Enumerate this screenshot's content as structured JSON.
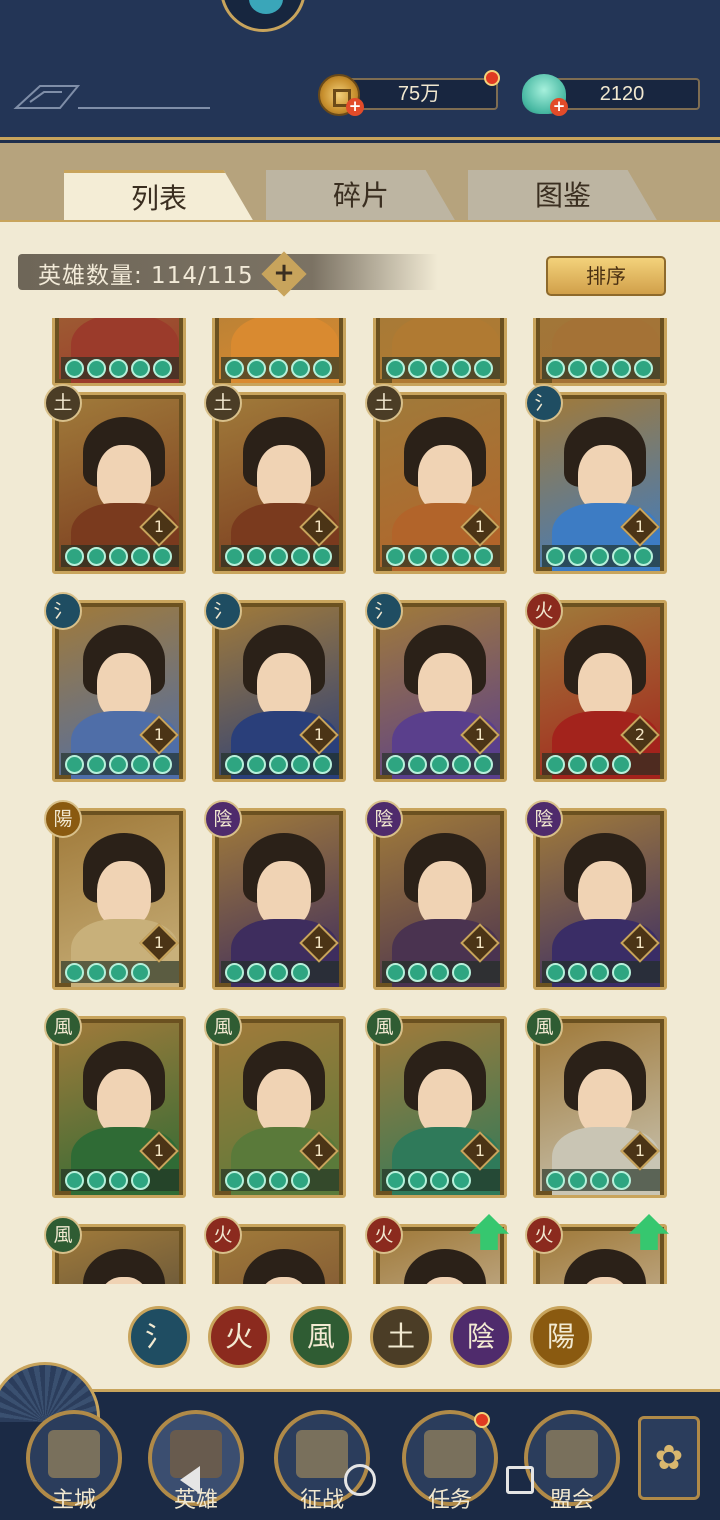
{
  "header": {
    "currencies": [
      {
        "name": "coin",
        "value": "75万",
        "icon": "coin-icon",
        "has_red_dot": true
      },
      {
        "name": "jade",
        "value": "2120",
        "icon": "shell-icon",
        "has_red_dot": false
      }
    ]
  },
  "tabs": [
    {
      "label": "列表",
      "active": true
    },
    {
      "label": "碎片",
      "active": false
    },
    {
      "label": "图鉴",
      "active": false
    }
  ],
  "hero_count": {
    "text": "英雄数量: 114/115"
  },
  "sort_button": {
    "label": "排序"
  },
  "elements": {
    "water": {
      "glyph": "氵",
      "color": "#1f4d62"
    },
    "fire": {
      "glyph": "火",
      "color": "#8b2a1e"
    },
    "wind": {
      "glyph": "風",
      "color": "#2f5c33"
    },
    "earth": {
      "glyph": "土",
      "color": "#4b3d26"
    },
    "yin": {
      "glyph": "陰",
      "color": "#4f2b6c"
    },
    "yang": {
      "glyph": "陽",
      "color": "#8a5a10"
    }
  },
  "hero_rows": [
    {
      "row": "partial-top",
      "cards": [
        {
          "element": null,
          "stars": 5,
          "level": null,
          "palette": "#9b3b2b"
        },
        {
          "element": null,
          "stars": 5,
          "level": null,
          "palette": "#d98a30"
        },
        {
          "element": null,
          "stars": 5,
          "level": null,
          "palette": "#b07a32"
        },
        {
          "element": null,
          "stars": 5,
          "level": null,
          "palette": "#a47236"
        }
      ]
    },
    {
      "row": "1",
      "cards": [
        {
          "element": "earth",
          "stars": 5,
          "level": "1",
          "palette": "#7a3a1e"
        },
        {
          "element": "earth",
          "stars": 5,
          "level": "1",
          "palette": "#7a3a1e"
        },
        {
          "element": "earth",
          "stars": 5,
          "level": "1",
          "palette": "#b2642a"
        },
        {
          "element": "water",
          "stars": 5,
          "level": "1",
          "palette": "#3d7cc4"
        }
      ]
    },
    {
      "row": "2",
      "cards": [
        {
          "element": "water",
          "stars": 5,
          "level": "1",
          "palette": "#4f6ea8"
        },
        {
          "element": "water",
          "stars": 5,
          "level": "1",
          "palette": "#2a3f7a"
        },
        {
          "element": "water",
          "stars": 5,
          "level": "1",
          "palette": "#5a3f8c"
        },
        {
          "element": "fire",
          "stars": 4,
          "level": "2",
          "palette": "#a3231c"
        }
      ]
    },
    {
      "row": "3",
      "cards": [
        {
          "element": "yang",
          "stars": 4,
          "level": "1",
          "palette": "#c8b07a"
        },
        {
          "element": "yin",
          "stars": 4,
          "level": "1",
          "palette": "#3e2d5e"
        },
        {
          "element": "yin",
          "stars": 4,
          "level": "1",
          "palette": "#4a3350"
        },
        {
          "element": "yin",
          "stars": 4,
          "level": "1",
          "palette": "#3a2d66"
        }
      ]
    },
    {
      "row": "4",
      "cards": [
        {
          "element": "wind",
          "stars": 4,
          "level": "1",
          "palette": "#2f6b35"
        },
        {
          "element": "wind",
          "stars": 4,
          "level": "1",
          "palette": "#5a7a3a"
        },
        {
          "element": "wind",
          "stars": 4,
          "level": "1",
          "palette": "#2f7a5a"
        },
        {
          "element": "wind",
          "stars": 4,
          "level": "1",
          "palette": "#c9c5b4"
        }
      ]
    },
    {
      "row": "partial-bottom",
      "cards": [
        {
          "element": "wind",
          "stars": 0,
          "level": null,
          "palette": "#3a3a3a",
          "upgrade": false
        },
        {
          "element": "fire",
          "stars": 0,
          "level": null,
          "palette": "#6a4030",
          "upgrade": false
        },
        {
          "element": "fire",
          "stars": 0,
          "level": null,
          "palette": "#d8d0c4",
          "upgrade": true
        },
        {
          "element": "fire",
          "stars": 0,
          "level": null,
          "palette": "#d8d0c4",
          "upgrade": true
        }
      ]
    }
  ],
  "filters": [
    {
      "element": "water",
      "glyph": "氵"
    },
    {
      "element": "fire",
      "glyph": "火"
    },
    {
      "element": "wind",
      "glyph": "風"
    },
    {
      "element": "earth",
      "glyph": "土"
    },
    {
      "element": "yin",
      "glyph": "陰"
    },
    {
      "element": "yang",
      "glyph": "陽"
    }
  ],
  "bottom_nav": [
    {
      "label": "主城",
      "icon": "city-gate-icon",
      "active": false,
      "has_red_dot": false
    },
    {
      "label": "英雄",
      "icon": "hero-hat-icon",
      "active": true,
      "has_red_dot": false
    },
    {
      "label": "征战",
      "icon": "drum-icon",
      "active": false,
      "has_red_dot": false
    },
    {
      "label": "任务",
      "icon": "scroll-icon",
      "active": false,
      "has_red_dot": true
    },
    {
      "label": "盟会",
      "icon": "pavilion-icon",
      "active": false,
      "has_red_dot": false
    }
  ],
  "more_button": {
    "icon": "flower-menu-icon"
  }
}
